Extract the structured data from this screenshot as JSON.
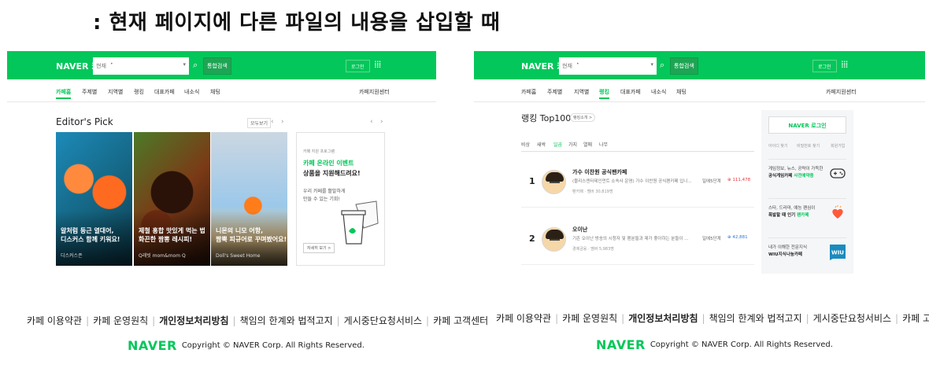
{
  "slide_title": ": 현재 페이지에 다른 파일의 내용을 삽입할 때",
  "header": {
    "logo": "NAVER 카페",
    "search_scope": "현재",
    "search_arrow": "•",
    "search_button": "통합검색",
    "login": "로그인"
  },
  "left_tabs": [
    "카페홈",
    "주제별",
    "지역별",
    "랭킹",
    "대표카페",
    "내소식",
    "채팅"
  ],
  "right_tabs": [
    "카페홈",
    "주제별",
    "지역별",
    "랭킹",
    "대표카페",
    "내소식",
    "채팅"
  ],
  "support": "카페지원센터",
  "editors_pick": {
    "title": "Editor's Pick",
    "more": "모두보기",
    "prev": "‹",
    "next": "›",
    "cards": [
      {
        "line1": "알처럼 둥근 열대어,",
        "line2": "디스커스 함께 키워요!",
        "sub": "디스커스존"
      },
      {
        "line1": "제철 홍합 맛있게 먹는 법",
        "line2": "화끈한 짬뽕 레시피!",
        "sub": "Q래빗 mom&mom Q"
      },
      {
        "line1": "니몬의 니모 어항,",
        "line2": "짬뿍 피규어로 꾸며봤어요!",
        "sub": "Doll's Sweet Home"
      }
    ],
    "ad": {
      "kicker": "카페 지원 프로그램",
      "headline1": "카페 온라인 이벤트",
      "headline2": "상품을 지원해드려요!",
      "desc": "우리 카페를 활발하게 만들 수 있는 기회!",
      "cta": "자세히 보기 >"
    }
  },
  "ranking": {
    "title": "랭킹 Top100",
    "badge": "랭킹소개 >",
    "periods": [
      "비상",
      "새싹",
      "일곱",
      "가지",
      "열매",
      "나무"
    ],
    "rows": [
      {
        "rank": "1",
        "name": "가수 이찬원 공식팬카페",
        "desc": "(블리스엔터테인먼트 소속사 운영) 가수 이찬원 공식팬카페 입니...",
        "meta": "팬카페 · 멤버 30,819명",
        "level": "일에5단계",
        "count": "111,478",
        "count_color": "#e8343a"
      },
      {
        "rank": "2",
        "name": "오이난",
        "desc": "기존 오이난 방송의 시청자 및 팬분들과 제가 좋아하는 분들이 ...",
        "meta": "경제금융 · 멤버 5,983명",
        "level": "일에5단계",
        "count": "42,881",
        "count_color": "#2a7ae2"
      }
    ]
  },
  "side": {
    "login": "NAVER 로그인",
    "links": [
      "아이디 찾기",
      "비밀번호 찾기",
      "회원가입"
    ],
    "items": [
      {
        "line1": "게임정보, 뉴스, 공략이 가득한",
        "line2a": "공식게임카페",
        "line2b": "사전예약중",
        "icon": "gamepad-icon"
      },
      {
        "line1": "스타, 드라마, 예능 팬심이",
        "line2a": "폭발할 때 인기",
        "line2b": "팬카페",
        "icon": "hearts-icon"
      },
      {
        "line1": "내가 이해한 전문지식",
        "line2a": "WIU지식나눔카페",
        "line2b": "",
        "icon": "wiu-icon"
      }
    ],
    "wiu": "WIU"
  },
  "footer": {
    "links": [
      "카페 이용약관",
      "카페 운영원칙",
      "개인정보처리방침",
      "책임의 한계와 법적고지",
      "게시중단요청서비스",
      "카페 고객센터"
    ],
    "brand": "NAVER",
    "copyright": "Copyright © NAVER Corp. All Rights Reserved."
  },
  "colors": {
    "brand_green": "#03c75a"
  }
}
